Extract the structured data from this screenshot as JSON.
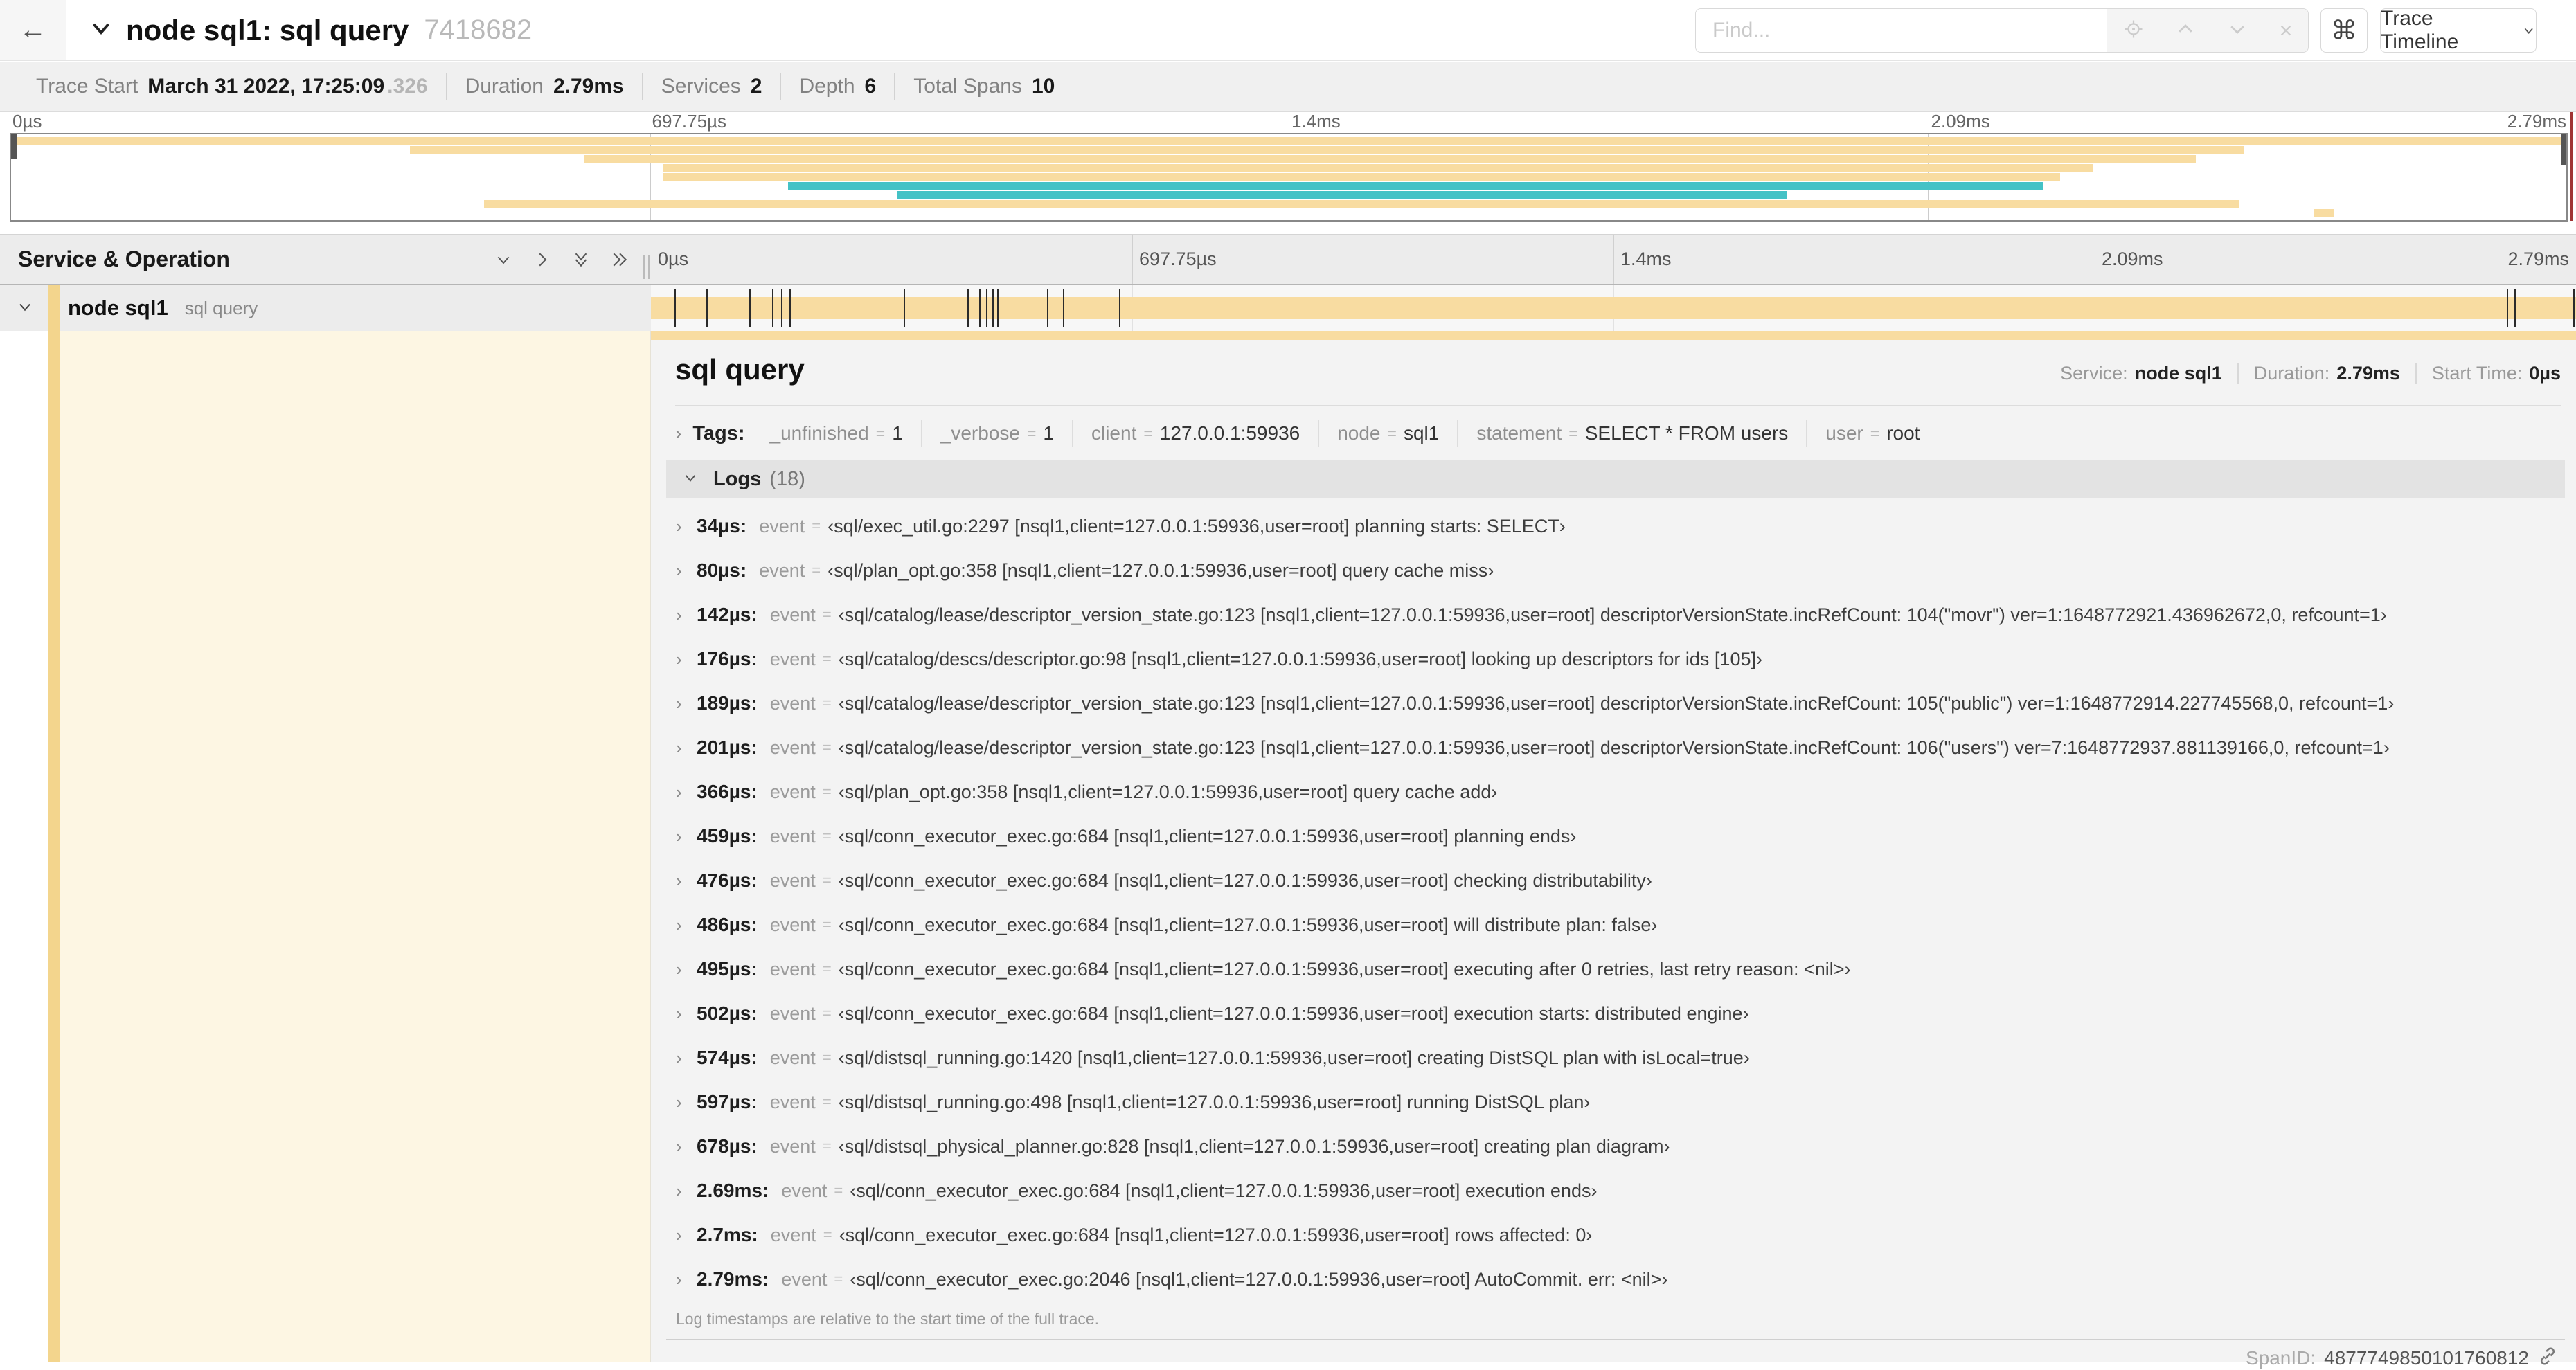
{
  "header": {
    "back": "←",
    "title": "node sql1: sql query",
    "trace_id_short": "7418682",
    "find_placeholder": "Find...",
    "shortcut_key": "⌘",
    "view_selector": "Trace Timeline"
  },
  "summary": {
    "items": [
      {
        "label": "Trace Start",
        "value": "March 31 2022, 17:25:09",
        "suffix": ".326"
      },
      {
        "label": "Duration",
        "value": "2.79ms"
      },
      {
        "label": "Services",
        "value": "2"
      },
      {
        "label": "Depth",
        "value": "6"
      },
      {
        "label": "Total Spans",
        "value": "10"
      }
    ]
  },
  "minimap": {
    "ticks": [
      "0µs",
      "697.75µs",
      "1.4ms",
      "2.09ms",
      "2.79ms"
    ],
    "colors": {
      "tan": "#F8DCA1",
      "teal": "#44C2C6"
    },
    "rows": [
      {
        "start": 0,
        "end": 100,
        "color": "tan"
      },
      {
        "start": 15.6,
        "end": 87.4,
        "color": "tan"
      },
      {
        "start": 22.4,
        "end": 85.5,
        "color": "tan"
      },
      {
        "start": 25.5,
        "end": 81.5,
        "color": "tan"
      },
      {
        "start": 25.5,
        "end": 80.2,
        "color": "tan"
      },
      {
        "start": 30.4,
        "end": 79.5,
        "color": "teal"
      },
      {
        "start": 34.7,
        "end": 69.5,
        "color": "teal"
      },
      {
        "start": 18.5,
        "end": 87.2,
        "color": "tan"
      },
      {
        "start": 90.1,
        "end": 90.9,
        "color": "tan"
      }
    ]
  },
  "grid": {
    "left_header": "Service & Operation",
    "ticks": [
      "0µs",
      "697.75µs",
      "1.4ms",
      "2.09ms",
      "2.79ms"
    ]
  },
  "span_row": {
    "service": "node sql1",
    "operation": "sql query",
    "bar": {
      "start": 0,
      "end": 100
    },
    "tick_pcts": [
      1.22,
      2.87,
      5.09,
      6.31,
      6.77,
      7.2,
      13.12,
      16.45,
      17.06,
      17.42,
      17.74,
      18.0,
      20.57,
      21.4,
      24.3,
      96.4,
      96.8,
      99.85
    ]
  },
  "detail": {
    "operation": "sql query",
    "service_label": "Service:",
    "service": "node sql1",
    "duration_label": "Duration:",
    "duration": "2.79ms",
    "start_label": "Start Time:",
    "start": "0µs",
    "tags_label": "Tags:",
    "tags": [
      {
        "key": "_unfinished",
        "value": "1"
      },
      {
        "key": "_verbose",
        "value": "1"
      },
      {
        "key": "client",
        "value": "127.0.0.1:59936"
      },
      {
        "key": "node",
        "value": "sql1"
      },
      {
        "key": "statement",
        "value": "SELECT * FROM users"
      },
      {
        "key": "user",
        "value": "root"
      }
    ],
    "logs_label": "Logs",
    "logs_count": "(18)",
    "log_field": "event",
    "logs": [
      {
        "t": "34µs:",
        "value": "‹sql/exec_util.go:2297 [nsql1,client=127.0.0.1:59936,user=root] planning starts: SELECT›"
      },
      {
        "t": "80µs:",
        "value": "‹sql/plan_opt.go:358 [nsql1,client=127.0.0.1:59936,user=root] query cache miss›"
      },
      {
        "t": "142µs:",
        "value": "‹sql/catalog/lease/descriptor_version_state.go:123 [nsql1,client=127.0.0.1:59936,user=root] descriptorVersionState.incRefCount: 104(\"movr\") ver=1:1648772921.436962672,0, refcount=1›"
      },
      {
        "t": "176µs:",
        "value": "‹sql/catalog/descs/descriptor.go:98 [nsql1,client=127.0.0.1:59936,user=root] looking up descriptors for ids [105]›"
      },
      {
        "t": "189µs:",
        "value": "‹sql/catalog/lease/descriptor_version_state.go:123 [nsql1,client=127.0.0.1:59936,user=root] descriptorVersionState.incRefCount: 105(\"public\") ver=1:1648772914.227745568,0, refcount=1›"
      },
      {
        "t": "201µs:",
        "value": "‹sql/catalog/lease/descriptor_version_state.go:123 [nsql1,client=127.0.0.1:59936,user=root] descriptorVersionState.incRefCount: 106(\"users\") ver=7:1648772937.881139166,0, refcount=1›"
      },
      {
        "t": "366µs:",
        "value": "‹sql/plan_opt.go:358 [nsql1,client=127.0.0.1:59936,user=root] query cache add›"
      },
      {
        "t": "459µs:",
        "value": "‹sql/conn_executor_exec.go:684 [nsql1,client=127.0.0.1:59936,user=root] planning ends›"
      },
      {
        "t": "476µs:",
        "value": "‹sql/conn_executor_exec.go:684 [nsql1,client=127.0.0.1:59936,user=root] checking distributability›"
      },
      {
        "t": "486µs:",
        "value": "‹sql/conn_executor_exec.go:684 [nsql1,client=127.0.0.1:59936,user=root] will distribute plan: false›"
      },
      {
        "t": "495µs:",
        "value": "‹sql/conn_executor_exec.go:684 [nsql1,client=127.0.0.1:59936,user=root] executing after 0 retries, last retry reason: <nil>›"
      },
      {
        "t": "502µs:",
        "value": "‹sql/conn_executor_exec.go:684 [nsql1,client=127.0.0.1:59936,user=root] execution starts: distributed engine›"
      },
      {
        "t": "574µs:",
        "value": "‹sql/distsql_running.go:1420 [nsql1,client=127.0.0.1:59936,user=root] creating DistSQL plan with isLocal=true›"
      },
      {
        "t": "597µs:",
        "value": "‹sql/distsql_running.go:498 [nsql1,client=127.0.0.1:59936,user=root] running DistSQL plan›"
      },
      {
        "t": "678µs:",
        "value": "‹sql/distsql_physical_planner.go:828 [nsql1,client=127.0.0.1:59936,user=root] creating plan diagram›"
      },
      {
        "t": "2.69ms:",
        "value": "‹sql/conn_executor_exec.go:684 [nsql1,client=127.0.0.1:59936,user=root] execution ends›"
      },
      {
        "t": "2.7ms:",
        "value": "‹sql/conn_executor_exec.go:684 [nsql1,client=127.0.0.1:59936,user=root] rows affected: 0›"
      },
      {
        "t": "2.79ms:",
        "value": "‹sql/conn_executor_exec.go:2046 [nsql1,client=127.0.0.1:59936,user=root] AutoCommit. err: <nil>›"
      }
    ],
    "logs_footnote": "Log timestamps are relative to the start time of the full trace.",
    "spanid_label": "SpanID:",
    "spanid": "4877749850101760812"
  }
}
